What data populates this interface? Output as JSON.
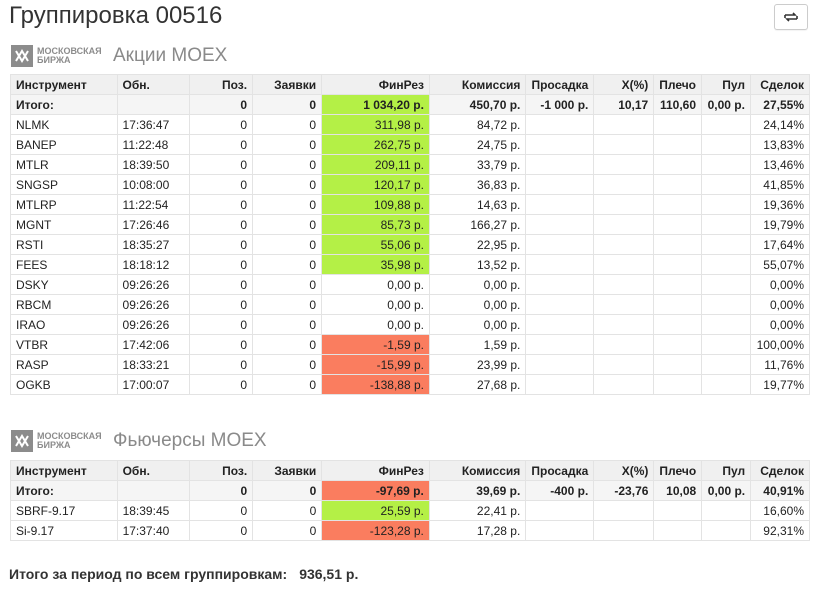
{
  "page_title": "Группировка 00516",
  "columns": [
    "Инструмент",
    "Обн.",
    "Поз.",
    "Заявки",
    "ФинРез",
    "Комиссия",
    "Просадка",
    "X(%)",
    "Плечо",
    "Пул",
    "Сделок"
  ],
  "sections": [
    {
      "logo_text_line1": "МОСКОВСКАЯ",
      "logo_text_line2": "БИРЖА",
      "title": "Акции MOEX",
      "total": {
        "name": "Итого:",
        "upd": "",
        "pos": "0",
        "orders": "0",
        "finres": "1 034,20 р.",
        "fee": "450,70 р.",
        "drawdown": "-1 000 р.",
        "x": "10,17",
        "leverage": "110,60",
        "pool": "0,00 р.",
        "deals": "27,55%",
        "state": "pos"
      },
      "rows": [
        {
          "name": "NLMK",
          "upd": "17:36:47",
          "pos": "0",
          "orders": "0",
          "finres": "311,98 р.",
          "fee": "84,72 р.",
          "drawdown": "",
          "x": "",
          "leverage": "",
          "pool": "",
          "deals": "24,14%",
          "state": "pos"
        },
        {
          "name": "BANEP",
          "upd": "11:22:48",
          "pos": "0",
          "orders": "0",
          "finres": "262,75 р.",
          "fee": "24,75 р.",
          "drawdown": "",
          "x": "",
          "leverage": "",
          "pool": "",
          "deals": "13,83%",
          "state": "pos"
        },
        {
          "name": "MTLR",
          "upd": "18:39:50",
          "pos": "0",
          "orders": "0",
          "finres": "209,11 р.",
          "fee": "33,79 р.",
          "drawdown": "",
          "x": "",
          "leverage": "",
          "pool": "",
          "deals": "13,46%",
          "state": "pos"
        },
        {
          "name": "SNGSP",
          "upd": "10:08:00",
          "pos": "0",
          "orders": "0",
          "finres": "120,17 р.",
          "fee": "36,83 р.",
          "drawdown": "",
          "x": "",
          "leverage": "",
          "pool": "",
          "deals": "41,85%",
          "state": "pos"
        },
        {
          "name": "MTLRP",
          "upd": "11:22:54",
          "pos": "0",
          "orders": "0",
          "finres": "109,88 р.",
          "fee": "14,63 р.",
          "drawdown": "",
          "x": "",
          "leverage": "",
          "pool": "",
          "deals": "19,36%",
          "state": "pos"
        },
        {
          "name": "MGNT",
          "upd": "17:26:46",
          "pos": "0",
          "orders": "0",
          "finres": "85,73 р.",
          "fee": "166,27 р.",
          "drawdown": "",
          "x": "",
          "leverage": "",
          "pool": "",
          "deals": "19,79%",
          "state": "pos"
        },
        {
          "name": "RSTI",
          "upd": "18:35:27",
          "pos": "0",
          "orders": "0",
          "finres": "55,06 р.",
          "fee": "22,95 р.",
          "drawdown": "",
          "x": "",
          "leverage": "",
          "pool": "",
          "deals": "17,64%",
          "state": "pos"
        },
        {
          "name": "FEES",
          "upd": "18:18:12",
          "pos": "0",
          "orders": "0",
          "finres": "35,98 р.",
          "fee": "13,52 р.",
          "drawdown": "",
          "x": "",
          "leverage": "",
          "pool": "",
          "deals": "55,07%",
          "state": "pos"
        },
        {
          "name": "DSKY",
          "upd": "09:26:26",
          "pos": "0",
          "orders": "0",
          "finres": "0,00 р.",
          "fee": "0,00 р.",
          "drawdown": "",
          "x": "",
          "leverage": "",
          "pool": "",
          "deals": "0,00%",
          "state": ""
        },
        {
          "name": "RBCM",
          "upd": "09:26:26",
          "pos": "0",
          "orders": "0",
          "finres": "0,00 р.",
          "fee": "0,00 р.",
          "drawdown": "",
          "x": "",
          "leverage": "",
          "pool": "",
          "deals": "0,00%",
          "state": ""
        },
        {
          "name": "IRAO",
          "upd": "09:26:26",
          "pos": "0",
          "orders": "0",
          "finres": "0,00 р.",
          "fee": "0,00 р.",
          "drawdown": "",
          "x": "",
          "leverage": "",
          "pool": "",
          "deals": "0,00%",
          "state": ""
        },
        {
          "name": "VTBR",
          "upd": "17:42:06",
          "pos": "0",
          "orders": "0",
          "finres": "-1,59 р.",
          "fee": "1,59 р.",
          "drawdown": "",
          "x": "",
          "leverage": "",
          "pool": "",
          "deals": "100,00%",
          "state": "neg"
        },
        {
          "name": "RASP",
          "upd": "18:33:21",
          "pos": "0",
          "orders": "0",
          "finres": "-15,99 р.",
          "fee": "23,99 р.",
          "drawdown": "",
          "x": "",
          "leverage": "",
          "pool": "",
          "deals": "11,76%",
          "state": "neg"
        },
        {
          "name": "OGKB",
          "upd": "17:00:07",
          "pos": "0",
          "orders": "0",
          "finres": "-138,88 р.",
          "fee": "27,68 р.",
          "drawdown": "",
          "x": "",
          "leverage": "",
          "pool": "",
          "deals": "19,77%",
          "state": "neg"
        }
      ]
    },
    {
      "logo_text_line1": "МОСКОВСКАЯ",
      "logo_text_line2": "БИРЖА",
      "title": "Фьючерсы MOEX",
      "total": {
        "name": "Итого:",
        "upd": "",
        "pos": "0",
        "orders": "0",
        "finres": "-97,69 р.",
        "fee": "39,69 р.",
        "drawdown": "-400 р.",
        "x": "-23,76",
        "leverage": "10,08",
        "pool": "0,00 р.",
        "deals": "40,91%",
        "state": "neg"
      },
      "rows": [
        {
          "name": "SBRF-9.17",
          "upd": "18:39:45",
          "pos": "0",
          "orders": "0",
          "finres": "25,59 р.",
          "fee": "22,41 р.",
          "drawdown": "",
          "x": "",
          "leverage": "",
          "pool": "",
          "deals": "16,60%",
          "state": "pos"
        },
        {
          "name": "Si-9.17",
          "upd": "17:37:40",
          "pos": "0",
          "orders": "0",
          "finres": "-123,28 р.",
          "fee": "17,28 р.",
          "drawdown": "",
          "x": "",
          "leverage": "",
          "pool": "",
          "deals": "92,31%",
          "state": "neg"
        }
      ]
    }
  ],
  "footer": {
    "label": "Итого за период по всем группировкам:",
    "value": "936,51 р."
  },
  "colors": {
    "positive": "#b4f046",
    "negative": "#fa7d5f",
    "header_bg": "#f0f0f0"
  },
  "icons": {
    "refresh": "refresh-icon",
    "logo": "moex-logo-icon"
  }
}
